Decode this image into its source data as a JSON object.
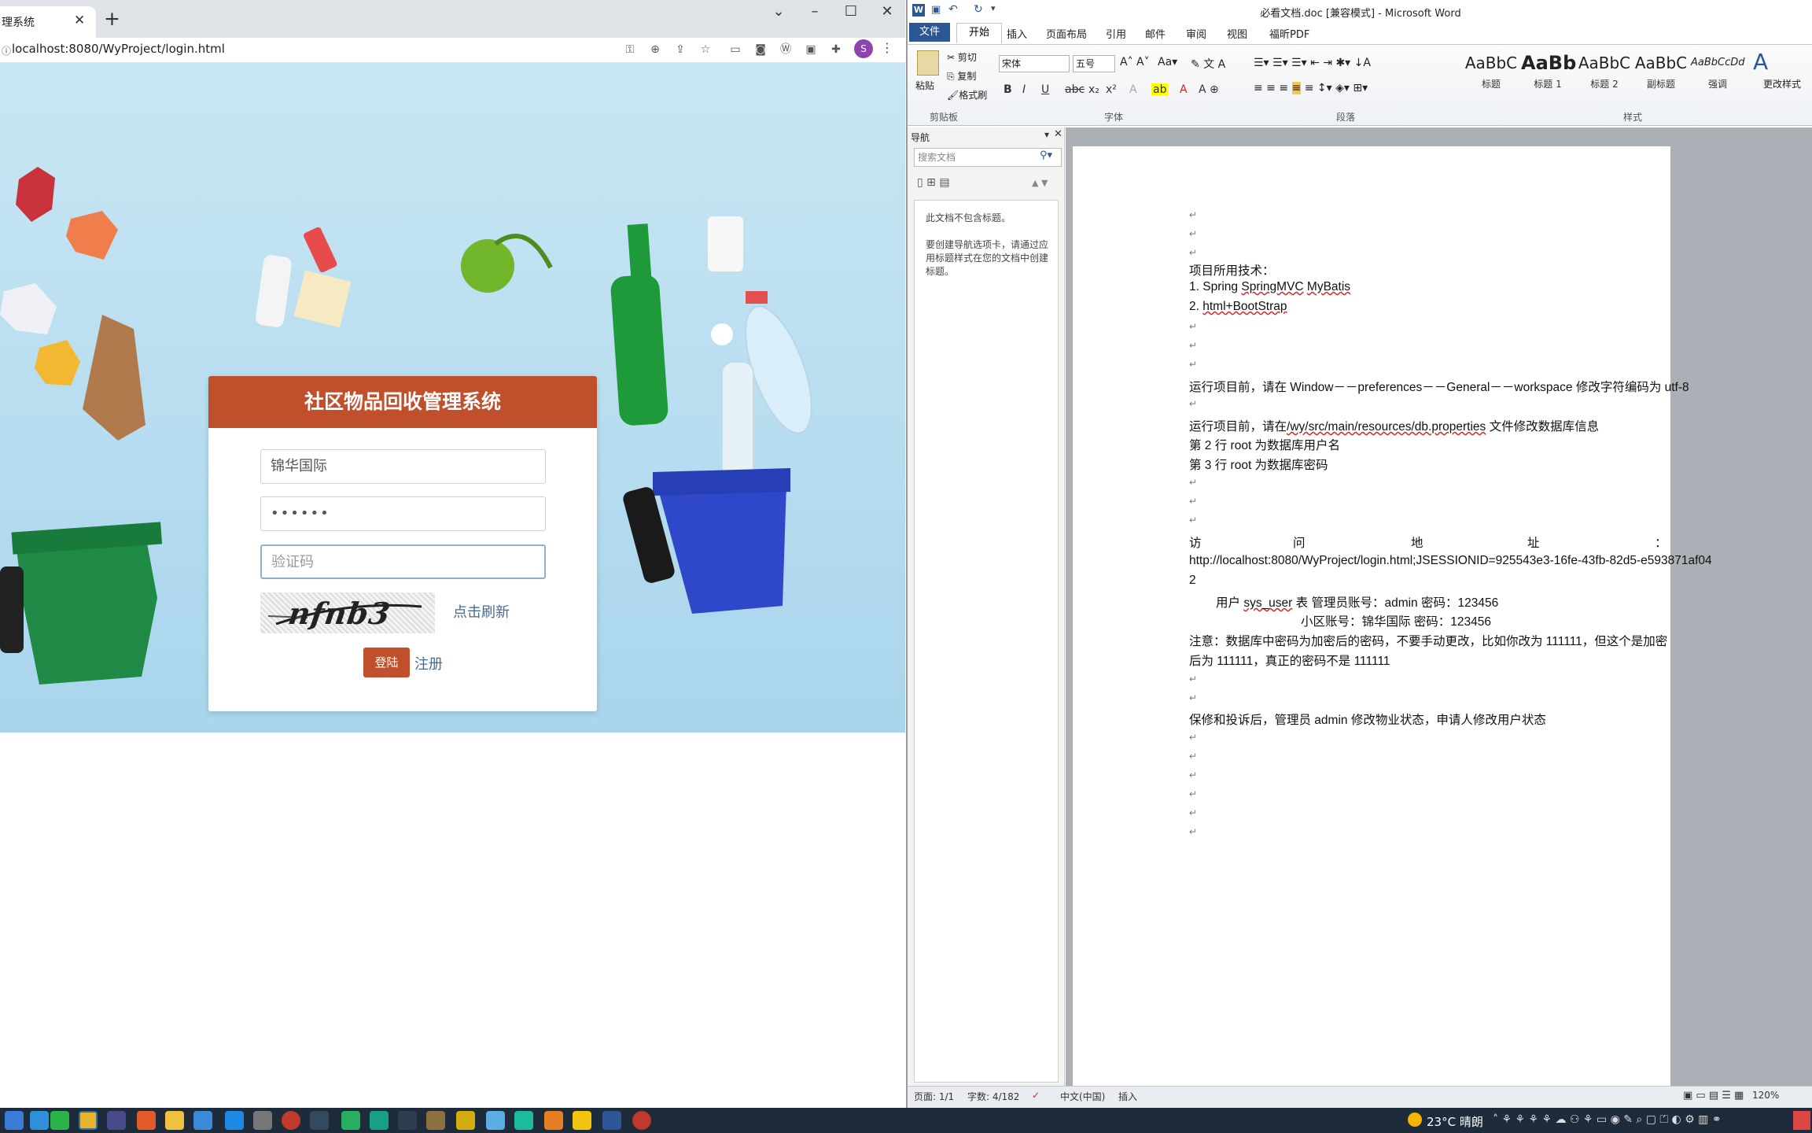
{
  "browser": {
    "tab_title": "理系统",
    "url_prefix": "ⓘ",
    "url": "localhost:8080/WyProject/login.html",
    "profile_initial": "S"
  },
  "login": {
    "title": "社区物品回收管理系统",
    "username_value": "锦华国际",
    "password_value": "••••••",
    "captcha_placeholder": "验证码",
    "captcha_image_text": "nfnb3",
    "refresh_label": "点击刷新",
    "login_button": "登陆",
    "register_link": "注册"
  },
  "word": {
    "window_title": "必看文档.doc [兼容模式] - Microsoft Word",
    "ribbon_tabs": [
      "文件",
      "开始",
      "插入",
      "页面布局",
      "引用",
      "邮件",
      "审阅",
      "视图",
      "福昕PDF"
    ],
    "clipboard": {
      "paste": "粘贴",
      "cut": "剪切",
      "copy": "复制",
      "format_painter": "格式刷",
      "group": "剪贴板"
    },
    "font": {
      "name": "宋体",
      "size": "五号",
      "group": "字体"
    },
    "paragraph_group": "段落",
    "styles_group": "样式",
    "styles": [
      {
        "sample": "AaBbC",
        "name": "标题"
      },
      {
        "sample": "AaBb",
        "name": "标题 1"
      },
      {
        "sample": "AaBbC",
        "name": "标题 2"
      },
      {
        "sample": "AaBbC",
        "name": "副标题"
      },
      {
        "sample": "AaBbCcDd",
        "name": "强调"
      }
    ],
    "change_styles": "更改样式",
    "nav": {
      "title": "导航",
      "search_placeholder": "搜索文档",
      "msg1": "此文档不包含标题。",
      "msg2": "要创建导航选项卡，请通过应用标题样式在您的文档中创建标题。"
    },
    "doc": {
      "l1": "项目所用技术：",
      "l2a": "1. Spring ",
      "l2b": "SpringMVC",
      "l2c": " ",
      "l2d": "MyBatis",
      "l3a": "2. ",
      "l3b": "html+BootStrap",
      "l4": "运行项目前，请在 Window－－preferences－－General－－workspace 修改字符编码为 utf-8",
      "l5a": "运行项目前，请在",
      "l5b": "/wy/src/main/resources/db.properties",
      "l5c": " 文件修改数据库信息",
      "l6": "第 2 行 root 为数据库用户名",
      "l7": "第 3 行 root 为数据库密码",
      "l8_words": [
        "访",
        "问",
        "地",
        "址",
        "："
      ],
      "l9": "http://localhost:8080/WyProject/login.html;JSESSIONID=925543e3-16fe-43fb-82d5-e593871af04",
      "l10": "2",
      "l11a": "用户 ",
      "l11b": "sys_user",
      "l11c": " 表   管理员账号：admin               密码：123456",
      "l12": "小区账号：锦华国际     密码：123456",
      "l13": "注意：数据库中密码为加密后的密码，不要手动更改，比如你改为  111111，但这个是加密",
      "l14": "后为 111111，真正的密码不是 111111",
      "l15": "保修和投诉后，管理员 admin 修改物业状态，申请人修改用户状态"
    },
    "status": {
      "page": "页面: 1/1",
      "words": "字数: 4/182",
      "lang": "中文(中国)",
      "mode": "插入",
      "zoom": "120%"
    }
  },
  "taskbar": {
    "weather": "23°C 晴朗"
  }
}
